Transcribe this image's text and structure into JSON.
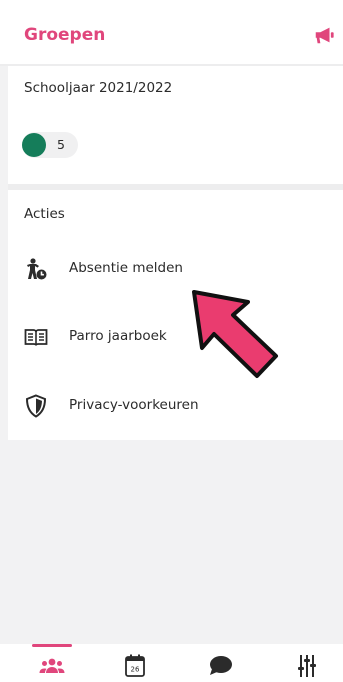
{
  "header": {
    "title": "Groepen",
    "announcement_icon": "megaphone-icon"
  },
  "year": {
    "label": "Schooljaar 2021/2022",
    "groups": [
      {
        "color": "#157d5a",
        "count": "5"
      }
    ]
  },
  "actions": {
    "title": "Acties",
    "items": [
      {
        "label": "Absentie melden",
        "icon": "person-absent-icon"
      },
      {
        "label": "Parro jaarboek",
        "icon": "book-icon"
      },
      {
        "label": "Privacy-voorkeuren",
        "icon": "shield-icon"
      }
    ]
  },
  "bottom_nav": {
    "active": "groups",
    "items": [
      {
        "name": "groups",
        "icon": "people-icon"
      },
      {
        "name": "calendar",
        "icon": "calendar-icon",
        "day": "26"
      },
      {
        "name": "chat",
        "icon": "chat-bubble-icon"
      },
      {
        "name": "settings",
        "icon": "sliders-icon"
      }
    ]
  },
  "colors": {
    "accent": "#e0467c",
    "group_green": "#157d5a",
    "arrow_fill": "#ea3c6f"
  }
}
